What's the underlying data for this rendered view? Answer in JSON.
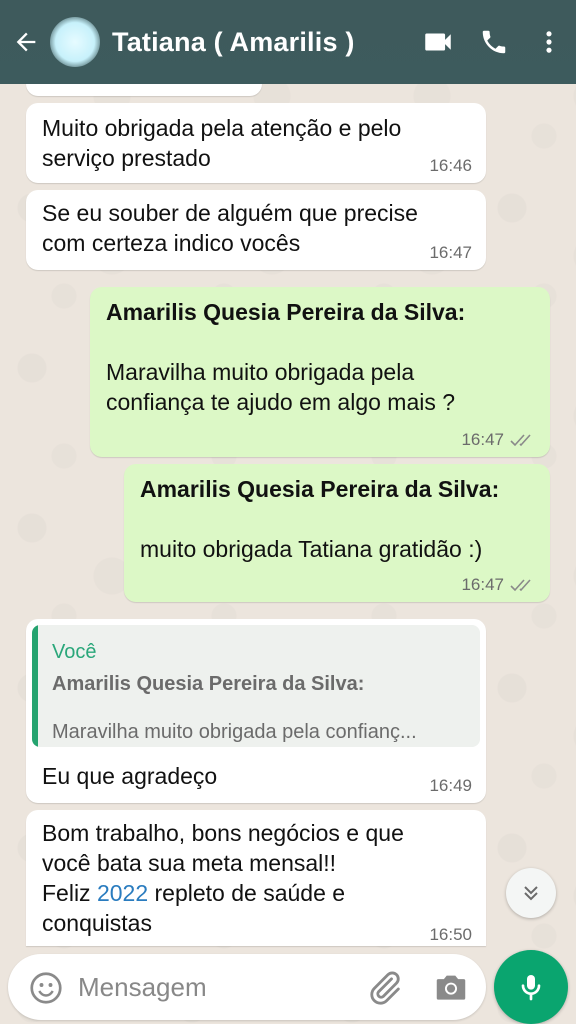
{
  "header": {
    "contact_name": "Tatiana ( Amarilis )",
    "icons": [
      "back-arrow-icon",
      "video-call-icon",
      "phone-icon",
      "more-options-icon"
    ]
  },
  "messages": [
    {
      "direction": "in",
      "text_lines": [
        "Muito obrigada pela atenção e pelo",
        "serviço prestado"
      ],
      "time": "16:46"
    },
    {
      "direction": "in",
      "text_lines": [
        "Se eu souber de alguém que precise",
        "com certeza indico vocês"
      ],
      "time": "16:47"
    },
    {
      "direction": "out",
      "sender": "Amarilis Quesia Pereira da Silva:",
      "text_lines": [
        "Maravilha muito obrigada pela",
        "confiança te ajudo em algo mais ?"
      ],
      "time": "16:47",
      "status": "read"
    },
    {
      "direction": "out",
      "sender": "Amarilis Quesia Pereira da Silva:",
      "text_lines": [
        "muito obrigada Tatiana gratidão :)"
      ],
      "time": "16:47",
      "status": "read"
    },
    {
      "direction": "in",
      "quote": {
        "author": "Você",
        "sender": "Amarilis Quesia Pereira da Silva:",
        "text": "Maravilha muito obrigada pela confianç..."
      },
      "text_lines": [
        "Eu que agradeço"
      ],
      "time": "16:49"
    },
    {
      "direction": "in",
      "text_lines": [
        "Bom trabalho, bons negócios e que",
        "você bata sua meta mensal!!"
      ],
      "text_line3_prefix": "Feliz ",
      "text_line3_link": "2022",
      "text_line3_suffix": " repleto de saúde e",
      "text_line4": "conquistas",
      "time": "16:50"
    }
  ],
  "composer": {
    "placeholder": "Mensagem"
  },
  "colors": {
    "header": "#3d5b5d",
    "incoming": "#ffffff",
    "outgoing": "#dcf8c6",
    "accent": "#0aa56f",
    "link": "#2a7cbf"
  }
}
